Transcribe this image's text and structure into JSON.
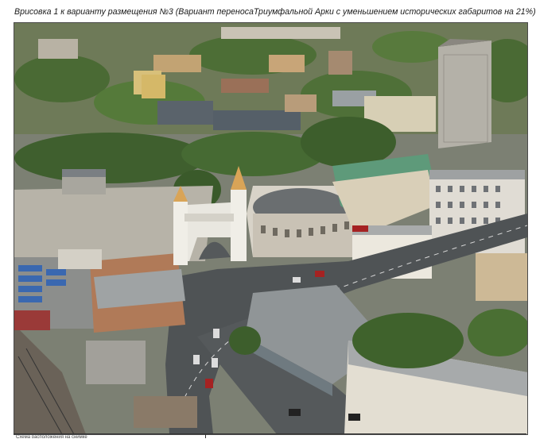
{
  "document": {
    "caption": "Врисовка 1 к варианту размещения №3 (Вариант переносаТриумфальной Арки с уменьшением исторических габаритов на 21%)",
    "photo_label": "aerial-city-photo",
    "table_fragment": "Схема расположения на снимке"
  },
  "colors": {
    "foliage_dark": "#3d5a2c",
    "foliage_light": "#6b8a45",
    "asphalt": "#5a5d5f",
    "roof_grey": "#8e9497",
    "arch_white": "#e8e6df"
  }
}
